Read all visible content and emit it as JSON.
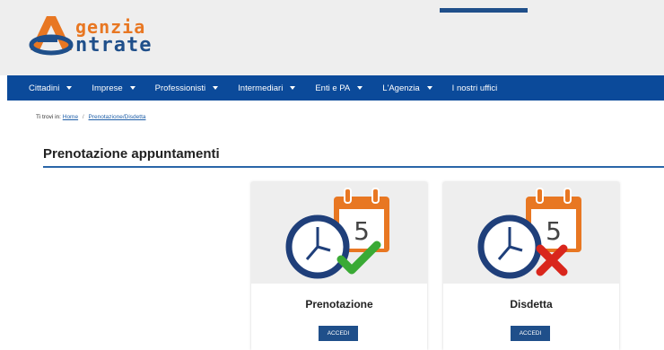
{
  "logo": {
    "line1": "genzia",
    "line2": "ntrate"
  },
  "nav": {
    "items": [
      {
        "label": "Cittadini",
        "caret": true
      },
      {
        "label": "Imprese",
        "caret": true
      },
      {
        "label": "Professionisti",
        "caret": true
      },
      {
        "label": "Intermediari",
        "caret": true
      },
      {
        "label": "Enti e PA",
        "caret": true
      },
      {
        "label": "L'Agenzia",
        "caret": true
      },
      {
        "label": "I nostri uffici",
        "caret": false
      }
    ]
  },
  "breadcrumb": {
    "prefix": "Ti trovi in:",
    "home": "Home",
    "sep": "/",
    "current": "Prenotazione/Disdetta"
  },
  "page": {
    "title": "Prenotazione appuntamenti"
  },
  "cards": [
    {
      "title": "Prenotazione",
      "button": "ACCEDI",
      "calendar_number": "5",
      "status": "check"
    },
    {
      "title": "Disdetta",
      "button": "ACCEDI",
      "calendar_number": "5",
      "status": "cross"
    }
  ],
  "colors": {
    "primary": "#0b4a9a",
    "accent_orange": "#e87722",
    "check_green": "#3aaa35",
    "cross_red": "#d9261c"
  }
}
